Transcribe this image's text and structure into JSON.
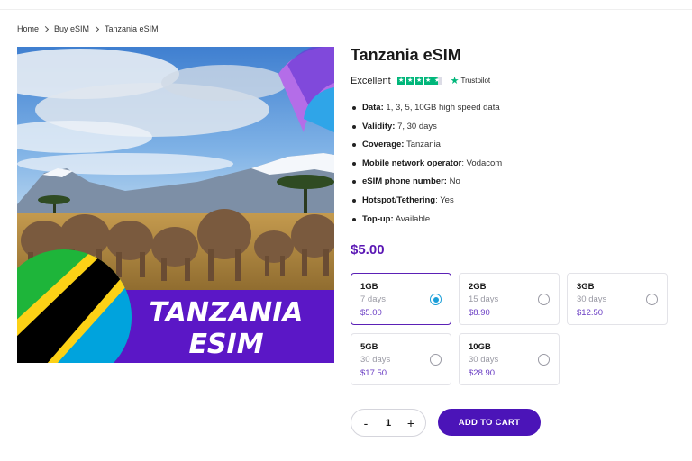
{
  "breadcrumb": [
    "Home",
    "Buy eSIM",
    "Tanzania eSIM"
  ],
  "product": {
    "title": "Tanzania eSIM",
    "rating_text": "Excellent",
    "rating_stars": 4.5,
    "trustpilot": "Trustpilot",
    "banner_line1": "TANZANIA",
    "banner_line2": "ESIM"
  },
  "specs": [
    {
      "key": "Data:",
      "value": "1, 3, 5, 10GB high speed data"
    },
    {
      "key": "Validity:",
      "value": "7, 30 days"
    },
    {
      "key": "Coverage:",
      "value": "Tanzania"
    },
    {
      "key": "Mobile network operator",
      "value": ": Vodacom"
    },
    {
      "key": "eSIM phone number:",
      "value": "No"
    },
    {
      "key": "Hotspot/Tethering",
      "value": ": Yes"
    },
    {
      "key": "Top-up:",
      "value": "Available"
    }
  ],
  "price": "$5.00",
  "plans": [
    {
      "gb": "1GB",
      "days": "7 days",
      "price": "$5.00",
      "selected": true
    },
    {
      "gb": "2GB",
      "days": "15 days",
      "price": "$8.90",
      "selected": false
    },
    {
      "gb": "3GB",
      "days": "30 days",
      "price": "$12.50",
      "selected": false
    },
    {
      "gb": "5GB",
      "days": "30 days",
      "price": "$17.50",
      "selected": false
    },
    {
      "gb": "10GB",
      "days": "30 days",
      "price": "$28.90",
      "selected": false
    }
  ],
  "quantity": {
    "minus": "-",
    "value": "1",
    "plus": "+"
  },
  "cart_button": "ADD TO CART",
  "colors": {
    "accent": "#4b14b8",
    "price": "#5a16b4",
    "trustpilot_green": "#00b67a",
    "radio": "#1a9ed8"
  }
}
